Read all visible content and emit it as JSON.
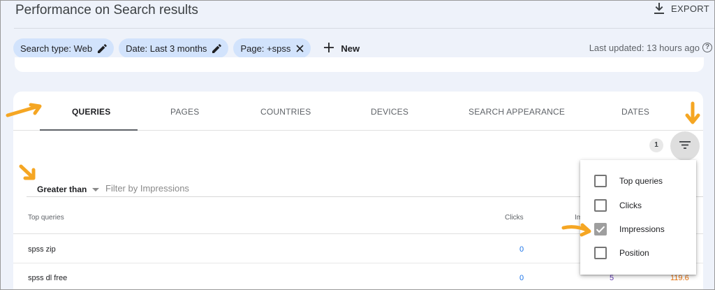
{
  "header": {
    "title": "Performance on Search results",
    "export_label": "EXPORT"
  },
  "filters": {
    "chips": [
      {
        "label": "Search type: Web",
        "action": "edit"
      },
      {
        "label": "Date: Last 3 months",
        "action": "edit"
      },
      {
        "label": "Page: +spss",
        "action": "remove"
      }
    ],
    "new_label": "New"
  },
  "last_updated": "Last updated: 13 hours ago",
  "tabs": [
    "QUERIES",
    "PAGES",
    "COUNTRIES",
    "DEVICES",
    "SEARCH APPEARANCE",
    "DATES"
  ],
  "active_tab": "QUERIES",
  "filter_count": "1",
  "metric_filter": {
    "operator": "Greater than",
    "placeholder": "Filter by Impressions"
  },
  "table": {
    "headers": {
      "query": "Top queries",
      "clicks": "Clicks",
      "impressions": "Im"
    },
    "rows": [
      {
        "query": "spss zip",
        "clicks": "0",
        "impressions": "",
        "position": ""
      },
      {
        "query": "spss dl free",
        "clicks": "0",
        "impressions": "5",
        "position": "119.6"
      }
    ]
  },
  "metric_menu": {
    "items": [
      {
        "label": "Top queries",
        "checked": false
      },
      {
        "label": "Clicks",
        "checked": false
      },
      {
        "label": "Impressions",
        "checked": true
      },
      {
        "label": "Position",
        "checked": false
      }
    ]
  },
  "colors": {
    "chip_bg": "#d2e3fc",
    "clicks": "#1a73e8",
    "impressions": "#5e35b1",
    "position": "#e8710a",
    "annotation": "#f5a623"
  },
  "icons": [
    "download-icon",
    "pencil-icon",
    "close-icon",
    "plus-icon",
    "help-icon",
    "filter-list-icon",
    "caret-down-icon",
    "check-icon",
    "annotation-arrow-icon"
  ]
}
